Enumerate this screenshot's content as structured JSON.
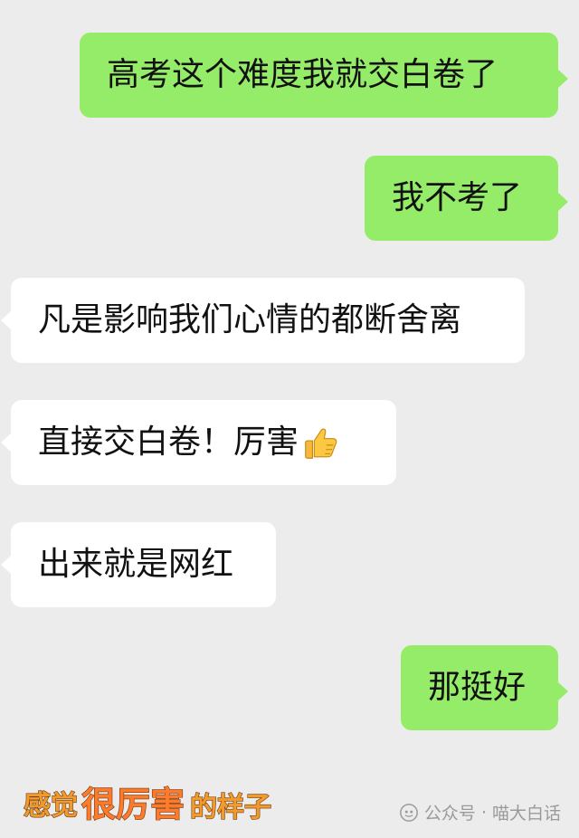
{
  "messages": [
    {
      "side": "outgoing",
      "text": "高考这个难度我就交白卷了"
    },
    {
      "side": "outgoing",
      "text": "我不考了"
    },
    {
      "side": "incoming",
      "text": "凡是影响我们心情的都断舍离"
    },
    {
      "side": "incoming",
      "text": "直接交白卷！厉害",
      "emoji": "thumbs-up-icon"
    },
    {
      "side": "incoming",
      "text": "出来就是网红"
    },
    {
      "side": "outgoing",
      "text": "那挺好"
    }
  ],
  "sticker": {
    "part1": "感觉",
    "part2": "很厉害",
    "part3": "的样子"
  },
  "watermark": {
    "label": "公众号",
    "separator": "·",
    "account": "喵大白话"
  },
  "colors": {
    "background": "#ececec",
    "outgoing_bubble": "#95ec69",
    "incoming_bubble": "#ffffff",
    "text": "#111111",
    "watermark": "#9a9a9a"
  }
}
